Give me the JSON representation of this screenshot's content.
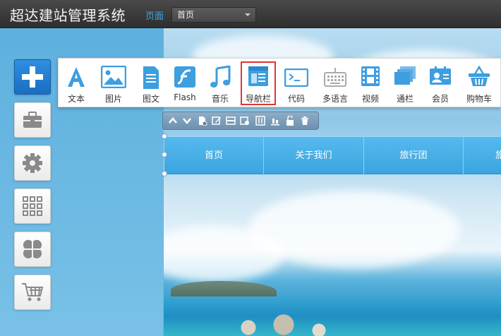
{
  "app": {
    "title": "超达建站管理系统"
  },
  "header": {
    "page_label": "页面",
    "page_select_value": "首页"
  },
  "toolbar": {
    "items": [
      {
        "label": "文本",
        "icon": "text-icon"
      },
      {
        "label": "图片",
        "icon": "image-icon"
      },
      {
        "label": "图文",
        "icon": "image-text-icon"
      },
      {
        "label": "Flash",
        "icon": "flash-icon"
      },
      {
        "label": "音乐",
        "icon": "music-icon"
      },
      {
        "label": "导航栏",
        "icon": "navbar-icon",
        "active": true
      },
      {
        "label": "代码",
        "icon": "code-icon"
      },
      {
        "label": "多语言",
        "icon": "keyboard-icon"
      },
      {
        "label": "视频",
        "icon": "video-icon"
      },
      {
        "label": "通栏",
        "icon": "banner-icon"
      },
      {
        "label": "会员",
        "icon": "member-icon"
      },
      {
        "label": "购物车",
        "icon": "basket-icon"
      }
    ]
  },
  "sidebar": {
    "buttons": [
      {
        "name": "add",
        "icon": "plus-icon"
      },
      {
        "name": "toolbox",
        "icon": "toolbox-icon"
      },
      {
        "name": "settings",
        "icon": "gear-icon"
      },
      {
        "name": "apps",
        "icon": "grid-icon"
      },
      {
        "name": "modules",
        "icon": "clover-icon"
      },
      {
        "name": "shop",
        "icon": "cart-icon"
      }
    ]
  },
  "navbar": {
    "items": [
      "首页",
      "关于我们",
      "旅行团",
      "旅"
    ]
  },
  "colors": {
    "accent": "#38a9e8",
    "nav_blue": "#3aa5e0",
    "active_outline": "#e13434",
    "add_button": "#1a6ec1"
  }
}
